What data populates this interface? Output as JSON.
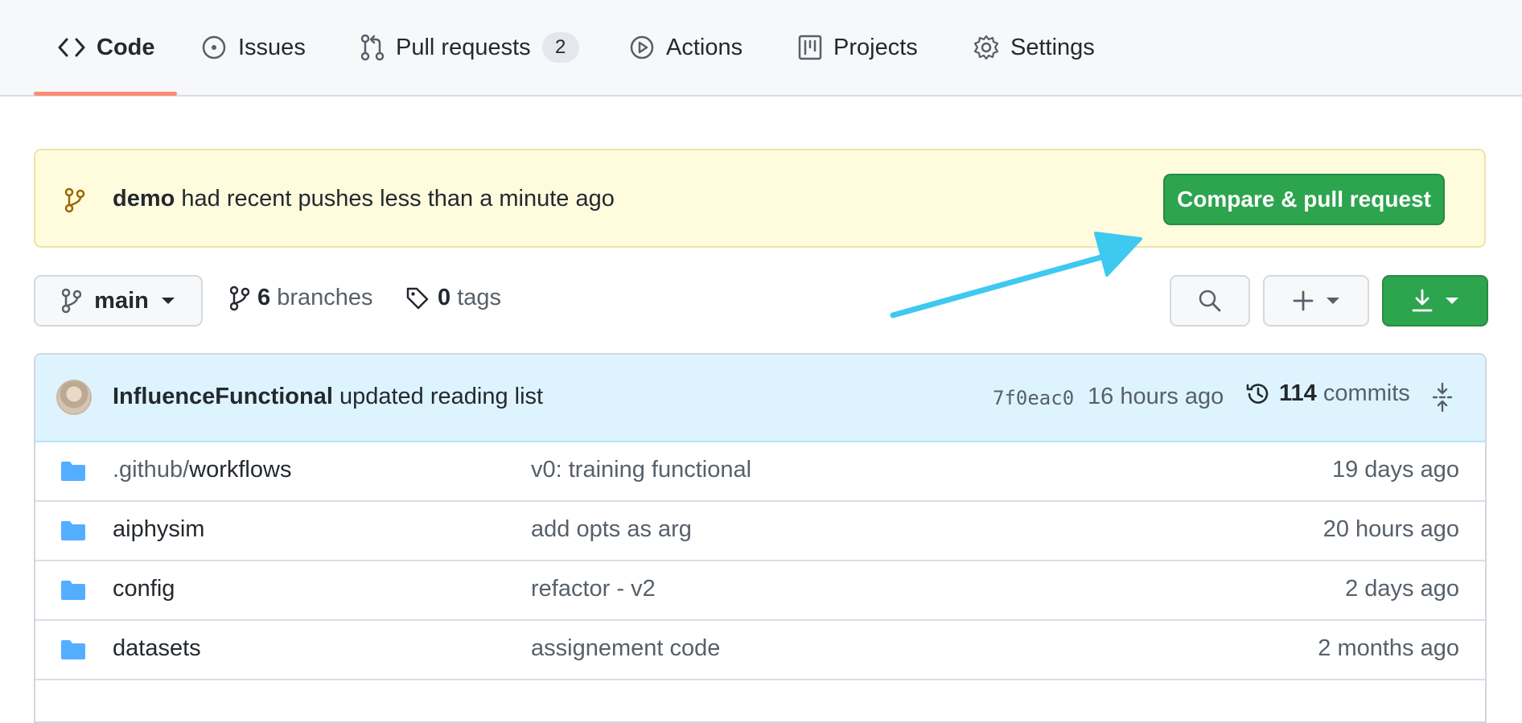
{
  "tabs": [
    {
      "label": "Code",
      "icon": "code-icon",
      "active": true
    },
    {
      "label": "Issues",
      "icon": "issue-opened-icon"
    },
    {
      "label": "Pull requests",
      "icon": "git-pull-request-icon",
      "counter": "2"
    },
    {
      "label": "Actions",
      "icon": "play-icon"
    },
    {
      "label": "Projects",
      "icon": "project-icon"
    },
    {
      "label": "Settings",
      "icon": "gear-icon"
    }
  ],
  "banner": {
    "branch": "demo",
    "text": " had recent pushes less than a minute ago",
    "button": "Compare & pull request"
  },
  "branch_row": {
    "current_branch": "main",
    "branches_count": "6",
    "branches_label": " branches",
    "tags_count": "0",
    "tags_label": " tags"
  },
  "latest_commit": {
    "author": "InfluenceFunctional",
    "message": " updated reading list",
    "sha": "7f0eac0",
    "time": "16 hours ago",
    "commits_count": "114",
    "commits_label": " commits"
  },
  "files": [
    {
      "dim": ".github/",
      "name": "workflows",
      "message": "v0: training functional",
      "age": "19 days ago"
    },
    {
      "dim": "",
      "name": "aiphysim",
      "message": "add opts as arg",
      "age": "20 hours ago"
    },
    {
      "dim": "",
      "name": "config",
      "message": "refactor - v2",
      "age": "2 days ago"
    },
    {
      "dim": "",
      "name": "datasets",
      "message": "assignement code",
      "age": "2 months ago"
    }
  ],
  "colors": {
    "primary_green": "#2da44e",
    "banner_bg": "#fffbdd",
    "tab_underline": "#fd8c73",
    "annotation_arrow": "#3ec9f0",
    "folder": "#54aeff"
  }
}
